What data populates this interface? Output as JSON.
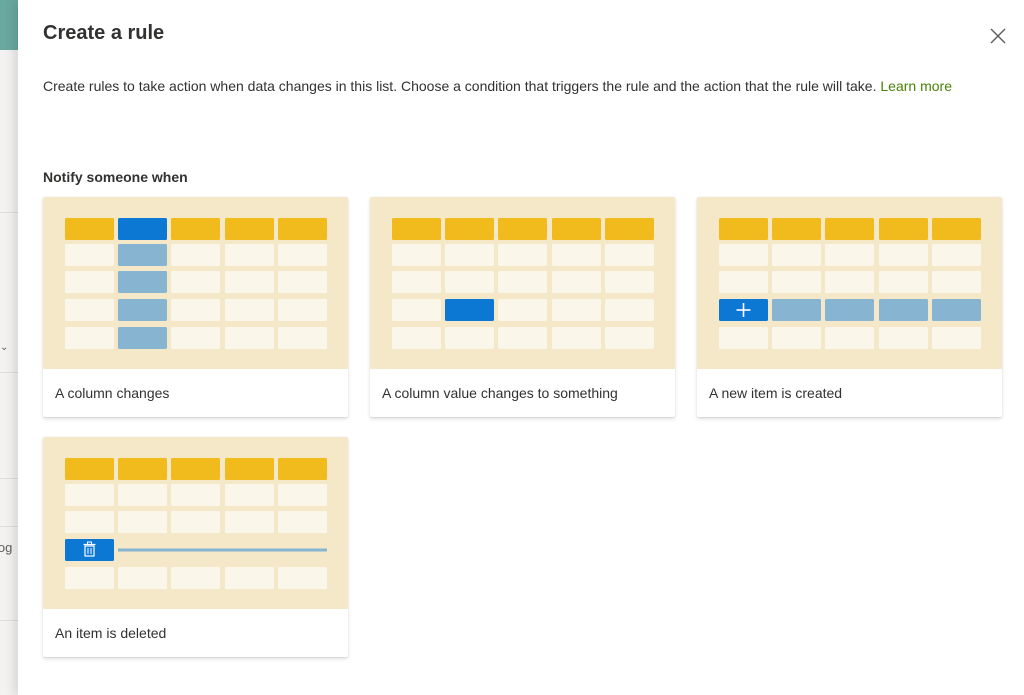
{
  "panel": {
    "title": "Create a rule",
    "description": "Create rules to take action when data changes in this list. Choose a condition that triggers the rule and the action that the rule will take.",
    "learn_more": "Learn more",
    "section_title": "Notify someone when"
  },
  "cards": [
    {
      "label": "A column changes",
      "illustration": "column-highlight"
    },
    {
      "label": "A column value changes to something",
      "illustration": "cell-highlight"
    },
    {
      "label": "A new item is created",
      "illustration": "add-row"
    },
    {
      "label": "An item is deleted",
      "illustration": "delete-row"
    }
  ],
  "background": {
    "fragment": "log"
  },
  "colors": {
    "header_cell": "#f2bb1d",
    "cell": "#fbf6ea",
    "thumb_bg": "#f5e8c8",
    "highlight": "#0c78d4",
    "selected_column": "#87b4d0",
    "link": "#498205"
  }
}
